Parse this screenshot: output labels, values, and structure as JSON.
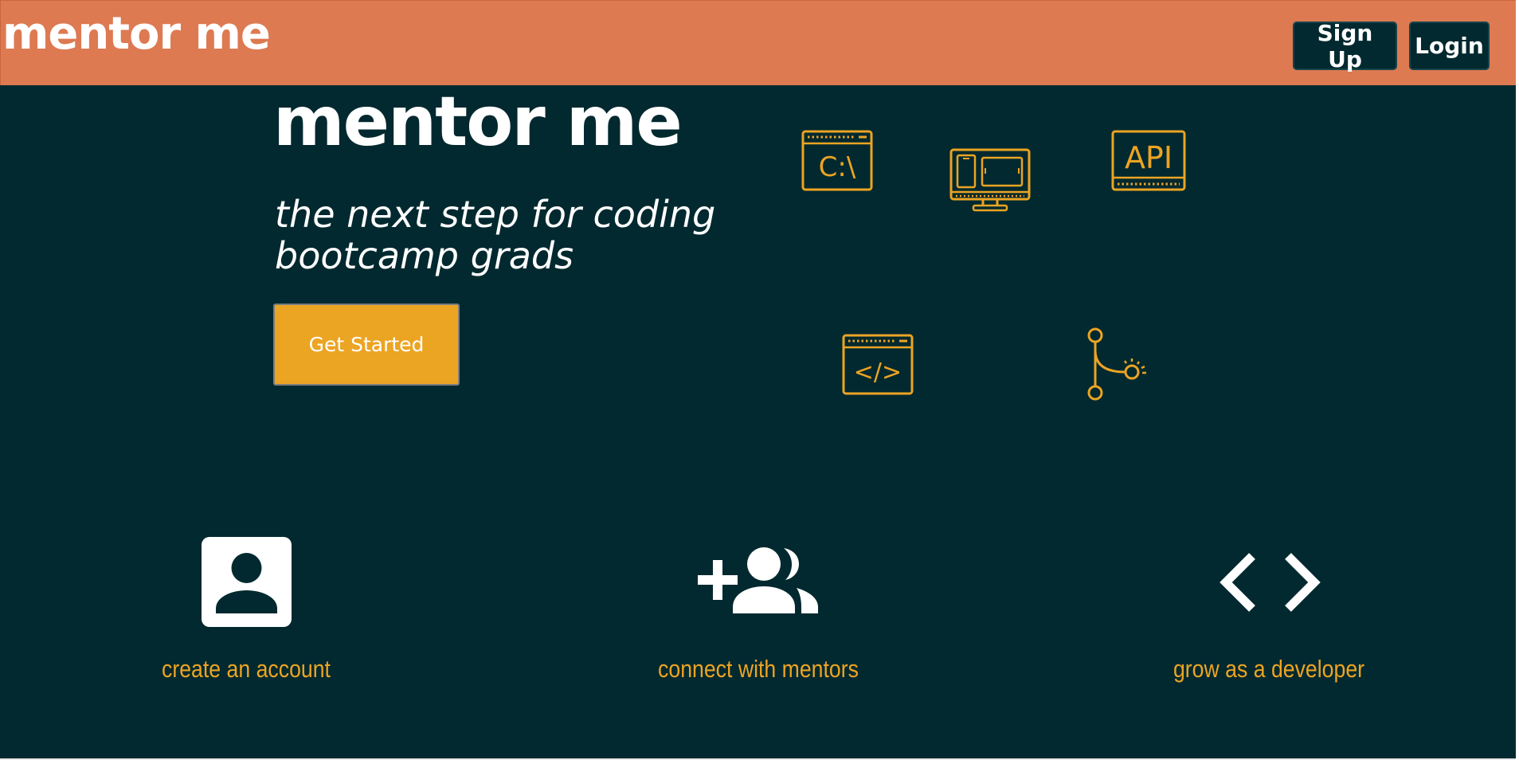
{
  "nav": {
    "brand": "mentor me",
    "signup_label": "Sign Up",
    "login_label": "Login"
  },
  "hero": {
    "title": "mentor me",
    "tagline_line1": "the next step for coding",
    "tagline_line2": "bootcamp grads",
    "cta_label": "Get Started"
  },
  "tech_icons": {
    "terminal_text": "C:\\",
    "api_text": "API",
    "code_text": "</>",
    "items": [
      "terminal-icon",
      "responsive-devices-icon",
      "api-icon",
      "code-window-icon",
      "git-branch-icon"
    ]
  },
  "features": [
    {
      "label": "create an account",
      "icon": "account-box-icon"
    },
    {
      "label": "connect with mentors",
      "icon": "add-group-icon"
    },
    {
      "label": "grow as a developer",
      "icon": "code-brackets-icon"
    }
  ],
  "colors": {
    "nav_bg": "#dd7a52",
    "main_bg": "#02292f",
    "accent": "#eca423",
    "text": "#ffffff"
  }
}
